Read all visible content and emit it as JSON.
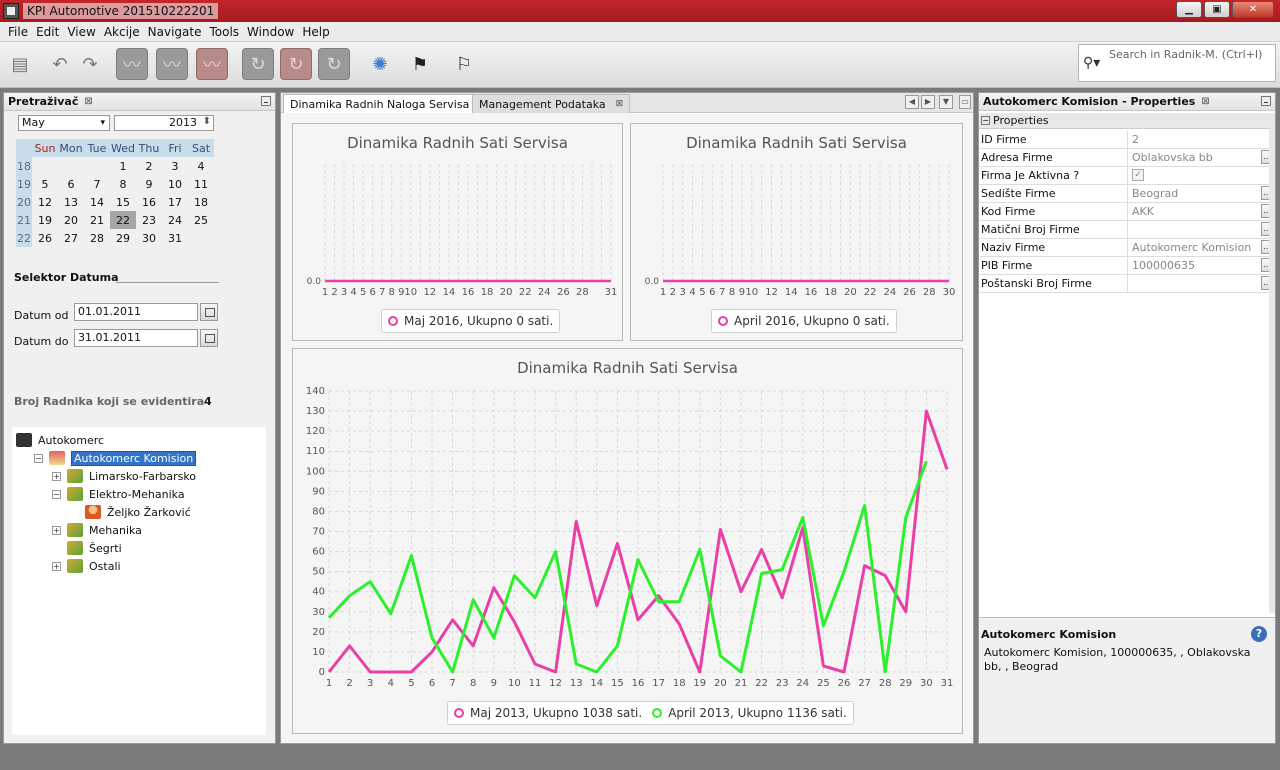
{
  "window": {
    "title": "KPI Automotive 201510222201",
    "min": "▁",
    "max": "▣",
    "close": "✕"
  },
  "menu": [
    "File",
    "Edit",
    "View",
    "Akcije",
    "Navigate",
    "Tools",
    "Window",
    "Help"
  ],
  "search": {
    "placeholder": "Search in Radnik-M. (Ctrl+I)",
    "icon": "search-icon"
  },
  "left": {
    "title": "Pretraživač",
    "calendar": {
      "month": "May",
      "year": "2013",
      "day_headers": [
        "Sun",
        "Mon",
        "Tue",
        "Wed",
        "Thu",
        "Fri",
        "Sat"
      ],
      "weeks": [
        {
          "wk": "18",
          "days": [
            "",
            "",
            "",
            "1",
            "2",
            "3",
            "4"
          ]
        },
        {
          "wk": "19",
          "days": [
            "5",
            "6",
            "7",
            "8",
            "9",
            "10",
            "11"
          ]
        },
        {
          "wk": "20",
          "days": [
            "12",
            "13",
            "14",
            "15",
            "16",
            "17",
            "18"
          ]
        },
        {
          "wk": "21",
          "days": [
            "19",
            "20",
            "21",
            "22",
            "23",
            "24",
            "25"
          ]
        },
        {
          "wk": "22",
          "days": [
            "26",
            "27",
            "28",
            "29",
            "30",
            "31",
            ""
          ]
        }
      ],
      "selected_day": "22"
    },
    "selector_title": "Selektor Datuma",
    "date_from_label": "Datum od",
    "date_from": "01.01.2011",
    "date_to_label": "Datum do",
    "date_to": "31.01.2011",
    "employees_label": "Broj Radnika koji se evidentira",
    "employees_count": "4",
    "tree": [
      {
        "label": "Autokomerc",
        "level": 0,
        "icon": "root",
        "exp": ""
      },
      {
        "label": "Autokomerc Komision",
        "level": 1,
        "icon": "company",
        "exp": "−",
        "selected": true
      },
      {
        "label": "Limarsko-Farbarsko",
        "level": 2,
        "icon": "dept",
        "exp": "+"
      },
      {
        "label": "Elektro-Mehanika",
        "level": 2,
        "icon": "dept",
        "exp": "−"
      },
      {
        "label": "Željko Žarković",
        "level": 3,
        "icon": "person",
        "exp": ""
      },
      {
        "label": "Mehanika",
        "level": 2,
        "icon": "dept",
        "exp": "+"
      },
      {
        "label": "Šegrti",
        "level": 2,
        "icon": "dept",
        "exp": ""
      },
      {
        "label": "Ostali",
        "level": 2,
        "icon": "dept",
        "exp": "+"
      }
    ]
  },
  "center": {
    "tabs": [
      {
        "label": "Dinamika Radnih Naloga Servisa",
        "active": true
      },
      {
        "label": "Management Podataka",
        "active": false
      }
    ]
  },
  "chart_data": [
    {
      "type": "line",
      "title": "Dinamika Radnih Sati Servisa",
      "x": [
        1,
        2,
        3,
        4,
        5,
        6,
        7,
        8,
        9,
        10,
        11,
        12,
        13,
        14,
        15,
        16,
        17,
        18,
        19,
        20,
        21,
        22,
        23,
        24,
        25,
        26,
        27,
        28,
        29,
        30,
        31
      ],
      "x_ticks": [
        1,
        2,
        3,
        4,
        5,
        6,
        7,
        8,
        9,
        10,
        12,
        14,
        16,
        18,
        20,
        22,
        24,
        26,
        28,
        31
      ],
      "y_ticks": [
        "0.0"
      ],
      "series": [
        {
          "name": "Maj 2016,  Ukupno 0 sati.",
          "color": "#ea3fa6",
          "values": [
            0,
            0,
            0,
            0,
            0,
            0,
            0,
            0,
            0,
            0,
            0,
            0,
            0,
            0,
            0,
            0,
            0,
            0,
            0,
            0,
            0,
            0,
            0,
            0,
            0,
            0,
            0,
            0,
            0,
            0,
            0
          ]
        }
      ]
    },
    {
      "type": "line",
      "title": "Dinamika Radnih Sati Servisa",
      "x": [
        1,
        2,
        3,
        4,
        5,
        6,
        7,
        8,
        9,
        10,
        11,
        12,
        13,
        14,
        15,
        16,
        17,
        18,
        19,
        20,
        21,
        22,
        23,
        24,
        25,
        26,
        27,
        28,
        29,
        30
      ],
      "x_ticks": [
        1,
        2,
        3,
        4,
        5,
        6,
        7,
        8,
        9,
        10,
        12,
        14,
        16,
        18,
        20,
        22,
        24,
        26,
        28,
        30
      ],
      "y_ticks": [
        "0.0"
      ],
      "series": [
        {
          "name": "April 2016,  Ukupno 0 sati.",
          "color": "#ea3fa6",
          "values": [
            0,
            0,
            0,
            0,
            0,
            0,
            0,
            0,
            0,
            0,
            0,
            0,
            0,
            0,
            0,
            0,
            0,
            0,
            0,
            0,
            0,
            0,
            0,
            0,
            0,
            0,
            0,
            0,
            0,
            0
          ]
        }
      ]
    },
    {
      "type": "line",
      "title": "Dinamika Radnih Sati Servisa",
      "x": [
        1,
        2,
        3,
        4,
        5,
        6,
        7,
        8,
        9,
        10,
        11,
        12,
        13,
        14,
        15,
        16,
        17,
        18,
        19,
        20,
        21,
        22,
        23,
        24,
        25,
        26,
        27,
        28,
        29,
        30,
        31
      ],
      "ylim": [
        0,
        140
      ],
      "y_ticks": [
        0,
        10,
        20,
        30,
        40,
        50,
        60,
        70,
        80,
        90,
        100,
        110,
        120,
        130,
        140
      ],
      "series": [
        {
          "name": "Maj 2013,  Ukupno 1038 sati.",
          "color": "#ea3fa6",
          "values": [
            0,
            13,
            0,
            0,
            0,
            10,
            26,
            13,
            42,
            25,
            4,
            0,
            75,
            33,
            64,
            26,
            38,
            24,
            0,
            71,
            40,
            61,
            37,
            72,
            3,
            0,
            53,
            48,
            30,
            130,
            101
          ]
        },
        {
          "name": "April 2013,  Ukupno 1136 sati.",
          "color": "#2bf02b",
          "values": [
            27,
            38,
            45,
            29,
            58,
            17,
            0,
            36,
            17,
            48,
            37,
            60,
            4,
            0,
            13,
            56,
            35,
            35,
            61,
            8,
            0,
            49,
            51,
            77,
            23,
            50,
            83,
            0,
            77,
            105
          ]
        }
      ]
    }
  ],
  "right": {
    "title": "Autokomerc Komision - Properties",
    "section": "Properties",
    "rows": [
      {
        "key": "ID Firme",
        "value": "2",
        "btn": false
      },
      {
        "key": "Adresa Firme",
        "value": "Oblakovska bb",
        "btn": true
      },
      {
        "key": "Firma Je Aktivna ?",
        "value": "✓",
        "btn": false,
        "checkbox": true
      },
      {
        "key": "Sedište Firme",
        "value": "Beograd",
        "btn": true
      },
      {
        "key": "Kod Firme",
        "value": "AKK",
        "btn": true
      },
      {
        "key": "Matični Broj Firme",
        "value": "",
        "btn": true
      },
      {
        "key": "Naziv Firme",
        "value": "Autokomerc Komision",
        "btn": true
      },
      {
        "key": "PIB Firme",
        "value": "100000635",
        "btn": true
      },
      {
        "key": "Poštanski Broj Firme",
        "value": "",
        "btn": true
      }
    ],
    "desc_title": "Autokomerc Komision",
    "desc_text": "Autokomerc Komision, 100000635, , Oblakovska bb, , Beograd"
  }
}
